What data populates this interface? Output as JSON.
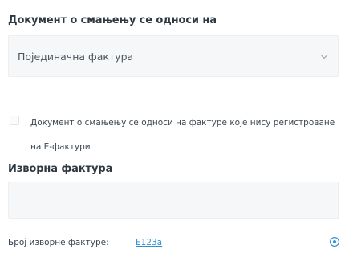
{
  "reference_section": {
    "title": "Документ о смањењу се односи на",
    "select": {
      "value": "Појединачна фактура",
      "icon": "chevron-down-icon"
    }
  },
  "not_registered_checkbox": {
    "checked": false,
    "label": "Документ о смањењу се односи на фактуре које нису регистроване на Е-фактури"
  },
  "source_invoice": {
    "title": "Изворна фактура",
    "input_value": "",
    "input_placeholder": ""
  },
  "source_number": {
    "label": "Број изворне фактуре:",
    "value": "E123a",
    "info_icon": "info-icon",
    "link_color": "#2f8fd0"
  }
}
